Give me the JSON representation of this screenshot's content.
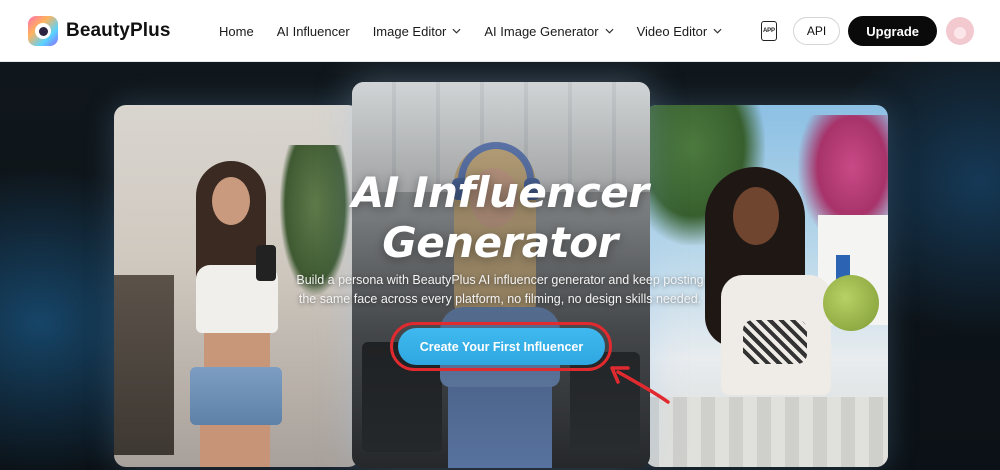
{
  "brand": {
    "name": "BeautyPlus",
    "logo_icon": "beautyplus-eye-logo"
  },
  "nav": {
    "items": [
      {
        "label": "Home",
        "dropdown": false
      },
      {
        "label": "AI Influencer",
        "dropdown": false
      },
      {
        "label": "Image Editor",
        "dropdown": true
      },
      {
        "label": "AI Image Generator",
        "dropdown": true
      },
      {
        "label": "Video Editor",
        "dropdown": true
      }
    ],
    "app_icon_text": "APP",
    "api_label": "API",
    "upgrade_label": "Upgrade"
  },
  "hero": {
    "title_line1": "AI Influencer",
    "title_line2": "Generator",
    "subtitle_line1": "Build a persona with BeautyPlus AI influencer generator and keep posting",
    "subtitle_line2": "the same face across every platform, no filming, no design skills needed.",
    "cta_label": "Create Your First Influencer"
  },
  "colors": {
    "cta": "#2fa6e0",
    "highlight_outline": "#e02a2f",
    "upgrade_bg": "#0a0a0a",
    "hero_bg": "#0d1216"
  }
}
